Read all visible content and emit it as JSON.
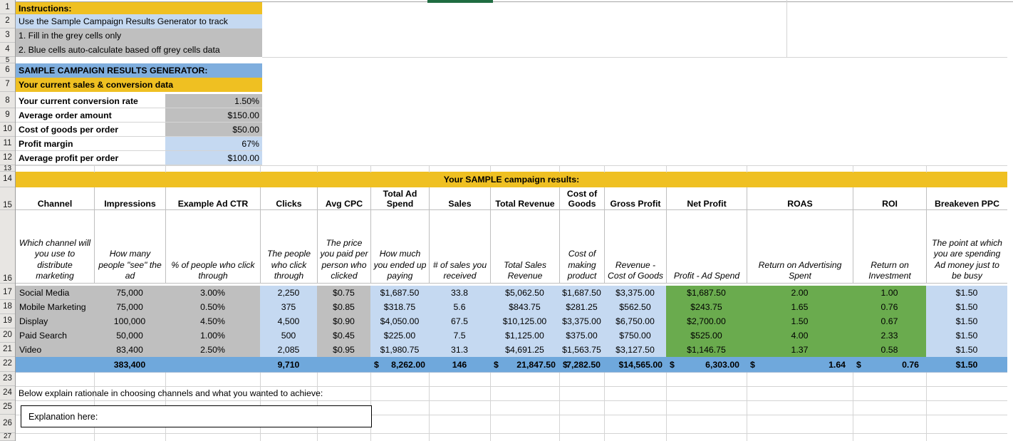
{
  "app": {
    "type": "spreadsheet",
    "row_numbers": [
      "1",
      "2",
      "3",
      "4",
      "5",
      "6",
      "7",
      "8",
      "9",
      "10",
      "11",
      "12",
      "13",
      "14",
      "15",
      "16",
      "17",
      "18",
      "19",
      "20",
      "21",
      "22",
      "23",
      "24",
      "25",
      "26",
      "27"
    ]
  },
  "colors": {
    "gold": "#EFC022",
    "light_blue": "#C5D9F1",
    "grey": "#BFBFBF",
    "header_blue": "#7FAEDE",
    "green": "#6AAB4E",
    "total_blue": "#6FA8DC",
    "green_tab": "#1F6C41"
  },
  "instructions": {
    "title": "Instructions:",
    "line1": "Use the Sample Campaign Results Generator to track",
    "line2": "1. Fill in the grey cells only",
    "line3": "2. Blue cells auto-calculate based off grey cells data"
  },
  "generator": {
    "title": "SAMPLE CAMPAIGN RESULTS GENERATOR:",
    "subtitle": "Your current sales & conversion data",
    "rows": [
      {
        "label": "Your current conversion rate",
        "value": "1.50%",
        "fill": "grey"
      },
      {
        "label": "Average order amount",
        "value": "$150.00",
        "fill": "grey"
      },
      {
        "label": "Cost of goods per order",
        "value": "$50.00",
        "fill": "grey"
      },
      {
        "label": "Profit margin",
        "value": "67%",
        "fill": "blue"
      },
      {
        "label": "Average profit per order",
        "value": "$100.00",
        "fill": "blue"
      }
    ]
  },
  "results": {
    "banner": "Your SAMPLE campaign results:",
    "headers": [
      "Channel",
      "Impressions",
      "Example Ad CTR",
      "Clicks",
      "Avg CPC",
      "Total Ad Spend",
      "Sales",
      "Total Revenue",
      "Cost of Goods",
      "Gross Profit",
      "Net Profit",
      "ROAS",
      "ROI",
      "Breakeven PPC"
    ],
    "descriptions": [
      "Which channel will you use to distribute marketing",
      "How many people \"see\" the ad",
      "% of people who click through",
      "The people who click through",
      "The price you paid per person who clicked",
      "How much you ended up paying",
      "# of sales you received",
      "Total Sales Revenue",
      "Cost of making product",
      "Revenue - Cost of Goods",
      "Profit - Ad Spend",
      "Return on Advertising Spent",
      "Return on Investment",
      "The point at which you are spending Ad money just to be busy"
    ],
    "rows": [
      {
        "channel": "Social Media",
        "impressions": "75,000",
        "ctr": "3.00%",
        "clicks": "2,250",
        "cpc": "$0.75",
        "ad_spend": "$1,687.50",
        "sales": "33.8",
        "revenue": "$5,062.50",
        "cogs": "$1,687.50",
        "gross_profit": "$3,375.00",
        "net_profit": "$1,687.50",
        "roas": "2.00",
        "roi": "1.00",
        "breakeven_ppc": "$1.50"
      },
      {
        "channel": "Mobile Marketing",
        "impressions": "75,000",
        "ctr": "0.50%",
        "clicks": "375",
        "cpc": "$0.85",
        "ad_spend": "$318.75",
        "sales": "5.6",
        "revenue": "$843.75",
        "cogs": "$281.25",
        "gross_profit": "$562.50",
        "net_profit": "$243.75",
        "roas": "1.65",
        "roi": "0.76",
        "breakeven_ppc": "$1.50"
      },
      {
        "channel": "Display",
        "impressions": "100,000",
        "ctr": "4.50%",
        "clicks": "4,500",
        "cpc": "$0.90",
        "ad_spend": "$4,050.00",
        "sales": "67.5",
        "revenue": "$10,125.00",
        "cogs": "$3,375.00",
        "gross_profit": "$6,750.00",
        "net_profit": "$2,700.00",
        "roas": "1.50",
        "roi": "0.67",
        "breakeven_ppc": "$1.50"
      },
      {
        "channel": "Paid Search",
        "impressions": "50,000",
        "ctr": "1.00%",
        "clicks": "500",
        "cpc": "$0.45",
        "ad_spend": "$225.00",
        "sales": "7.5",
        "revenue": "$1,125.00",
        "cogs": "$375.00",
        "gross_profit": "$750.00",
        "net_profit": "$525.00",
        "roas": "4.00",
        "roi": "2.33",
        "breakeven_ppc": "$1.50"
      },
      {
        "channel": "Video",
        "impressions": "83,400",
        "ctr": "2.50%",
        "clicks": "2,085",
        "cpc": "$0.95",
        "ad_spend": "$1,980.75",
        "sales": "31.3",
        "revenue": "$4,691.25",
        "cogs": "$1,563.75",
        "gross_profit": "$3,127.50",
        "net_profit": "$1,146.75",
        "roas": "1.37",
        "roi": "0.58",
        "breakeven_ppc": "$1.50"
      }
    ],
    "totals": {
      "channel": "",
      "impressions": "383,400",
      "ctr": "",
      "clicks": "9,710",
      "cpc": "",
      "ad_spend_symbol": "$",
      "ad_spend": "8,262.00",
      "sales": "146",
      "revenue_symbol": "$",
      "revenue": "21,847.50",
      "cogs_symbol": "$",
      "cogs": "7,282.50",
      "gross_profit": "$14,565.00",
      "net_profit_symbol": "$",
      "net_profit": "6,303.00",
      "roas_symbol": "$",
      "roas": "1.64",
      "roi_symbol": "$",
      "roi": "0.76",
      "breakeven_ppc": "$1.50"
    }
  },
  "rationale": {
    "prompt": "Below explain rationale in choosing channels and what you wanted to achieve:",
    "placeholder_text": "Explanation here:"
  }
}
